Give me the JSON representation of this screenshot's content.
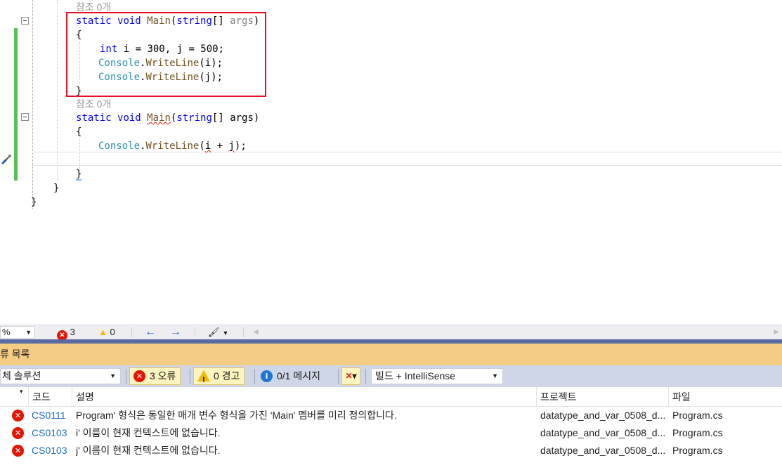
{
  "editor": {
    "lines": [
      {
        "indent": 108,
        "segments": [
          {
            "cls": "ref",
            "t": "참조 0개"
          }
        ]
      },
      {
        "indent": 108,
        "segments": [
          {
            "cls": "kw",
            "t": "static"
          },
          {
            "t": " "
          },
          {
            "cls": "kw",
            "t": "void"
          },
          {
            "t": " "
          },
          {
            "cls": "mt",
            "t": "Main"
          },
          {
            "t": "("
          },
          {
            "cls": "kw",
            "t": "string"
          },
          {
            "t": "[] "
          },
          {
            "cls": "pr",
            "t": "args"
          },
          {
            "t": ")"
          }
        ]
      },
      {
        "indent": 108,
        "segments": [
          {
            "t": "{"
          }
        ]
      },
      {
        "indent": 142,
        "segments": [
          {
            "cls": "kw",
            "t": "int"
          },
          {
            "t": " i = 300, j = 500;"
          }
        ]
      },
      {
        "indent": 140,
        "segments": [
          {
            "cls": "ty",
            "t": "Console"
          },
          {
            "t": "."
          },
          {
            "cls": "mt",
            "t": "WriteLine"
          },
          {
            "t": "(i);"
          }
        ]
      },
      {
        "indent": 140,
        "segments": [
          {
            "cls": "ty",
            "t": "Console"
          },
          {
            "t": "."
          },
          {
            "cls": "mt",
            "t": "WriteLine"
          },
          {
            "t": "(j);"
          }
        ]
      },
      {
        "indent": 108,
        "segments": [
          {
            "t": "}"
          }
        ]
      },
      {
        "indent": 108,
        "segments": [
          {
            "cls": "ref",
            "t": "참조 0개"
          }
        ]
      },
      {
        "indent": 108,
        "segments": [
          {
            "cls": "kw",
            "t": "static"
          },
          {
            "t": " "
          },
          {
            "cls": "kw",
            "t": "void"
          },
          {
            "t": " "
          },
          {
            "cls": "mt sq",
            "t": "Main"
          },
          {
            "t": "("
          },
          {
            "cls": "kw",
            "t": "string"
          },
          {
            "t": "[] args)"
          }
        ]
      },
      {
        "indent": 108,
        "segments": [
          {
            "t": "{"
          }
        ]
      },
      {
        "indent": 140,
        "segments": [
          {
            "cls": "ty",
            "t": "Console"
          },
          {
            "t": "."
          },
          {
            "cls": "mt",
            "t": "WriteLine"
          },
          {
            "t": "("
          },
          {
            "cls": "sq",
            "t": "i"
          },
          {
            "t": " + "
          },
          {
            "cls": "sq",
            "t": "j"
          },
          {
            "t": ");"
          }
        ]
      },
      {
        "indent": 108,
        "segments": [
          {
            "t": ""
          }
        ]
      },
      {
        "indent": 108,
        "segments": [
          {
            "t": "}"
          }
        ]
      },
      {
        "indent": 76,
        "segments": [
          {
            "t": "}"
          }
        ]
      },
      {
        "indent": 44,
        "segments": [
          {
            "t": "}"
          }
        ]
      }
    ]
  },
  "status": {
    "zoom": "%",
    "error_count": "3",
    "warning_count": "0",
    "error_icon": "error-circle-icon",
    "warning_icon": "warning-triangle-icon"
  },
  "error_list": {
    "title": "류 목록",
    "scope": "체 솔루션",
    "errors_button": "3 오류",
    "warnings_button": "0 경고",
    "messages_button": "0/1 메시지",
    "source_filter": "빌드 + IntelliSense",
    "columns": {
      "code": "코드",
      "description": "설명",
      "project": "프로젝트",
      "file": "파일"
    },
    "rows": [
      {
        "code": "CS0111",
        "description": "Program' 형식은 동일한 매개 변수 형식을 가진 'Main' 멤버를 미리 정의합니다.",
        "project": "datatype_and_var_0508_d...",
        "file": "Program.cs"
      },
      {
        "code": "CS0103",
        "description": "i' 이름이 현재 컨텍스트에 없습니다.",
        "project": "datatype_and_var_0508_d...",
        "file": "Program.cs"
      },
      {
        "code": "CS0103",
        "description": "j' 이름이 현재 컨텍스트에 없습니다.",
        "project": "datatype_and_var_0508_d...",
        "file": "Program.cs"
      }
    ]
  },
  "colors": {
    "error": "#e51400",
    "accent": "#f5cc84",
    "highlight": "#e81123"
  }
}
